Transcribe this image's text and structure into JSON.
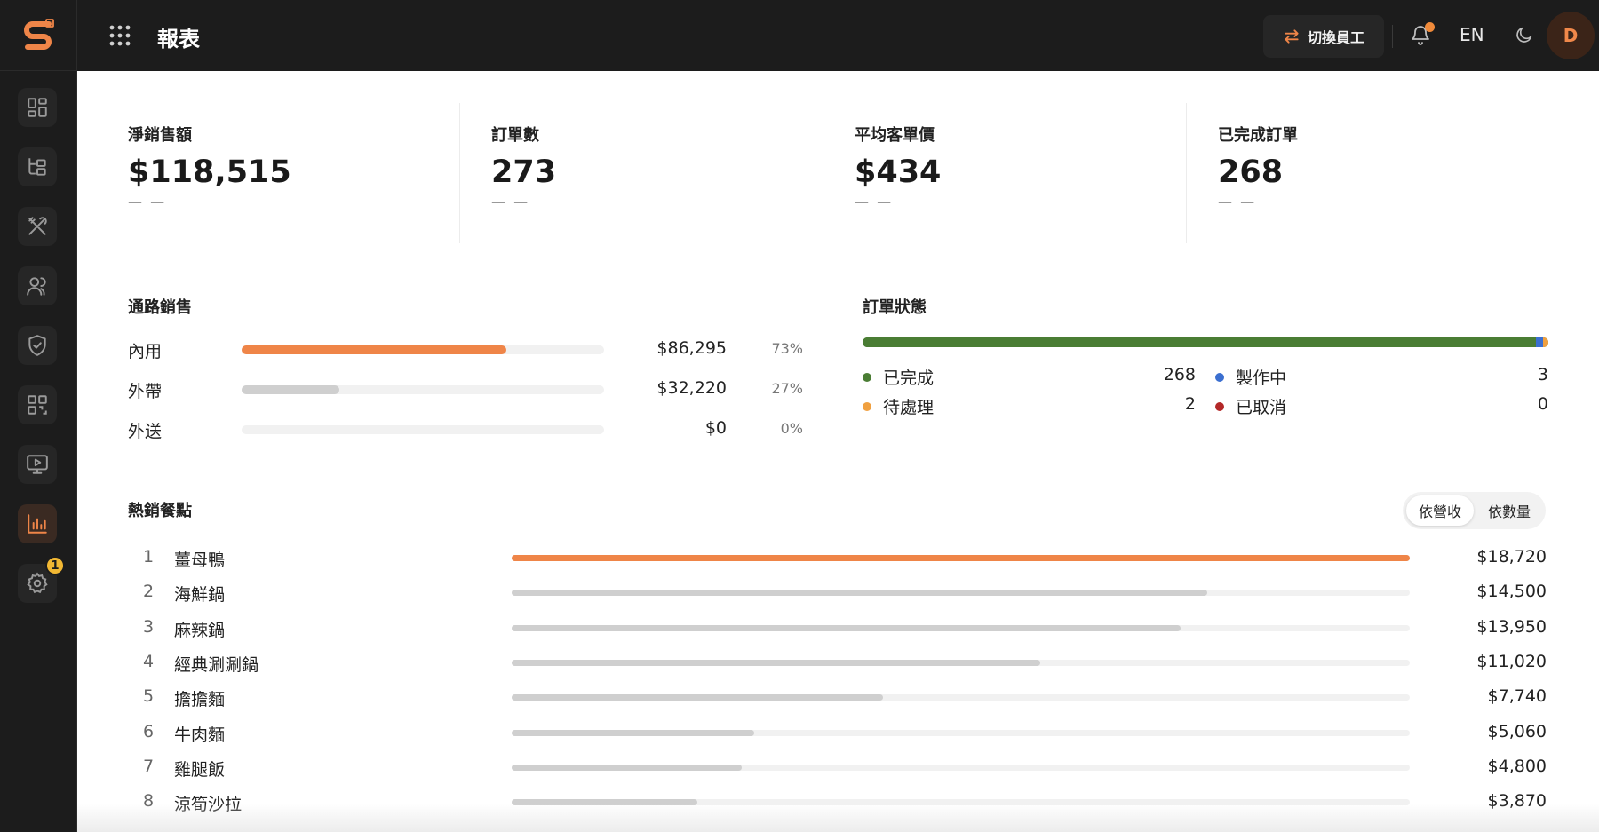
{
  "app": {
    "page_title": "報表"
  },
  "topbar": {
    "switch_label": "切換員工",
    "language": "EN",
    "avatar_initial": "D"
  },
  "sidebar": {
    "items": [
      {
        "icon": "dashboard-icon",
        "active": false
      },
      {
        "icon": "category-tree-icon",
        "active": false
      },
      {
        "icon": "utensils-icon",
        "active": false
      },
      {
        "icon": "users-icon",
        "active": false
      },
      {
        "icon": "shield-icon",
        "active": false
      },
      {
        "icon": "qr-code-icon",
        "active": false
      },
      {
        "icon": "monitor-play-icon",
        "active": false
      },
      {
        "icon": "bar-chart-icon",
        "active": true
      },
      {
        "icon": "gear-icon",
        "active": false,
        "badge": "1"
      }
    ]
  },
  "kpis": [
    {
      "label": "淨銷售額",
      "value": "$118,515",
      "sub": "— —"
    },
    {
      "label": "訂單數",
      "value": "273",
      "sub": "— —"
    },
    {
      "label": "平均客單價",
      "value": "$434",
      "sub": "— —"
    },
    {
      "label": "已完成訂單",
      "value": "268",
      "sub": "— —"
    }
  ],
  "channel_sales": {
    "title": "通路銷售",
    "rows": [
      {
        "name": "內用",
        "amount": "$86,295",
        "pct": "73%",
        "fraction": 0.73,
        "color": "#ef8548"
      },
      {
        "name": "外帶",
        "amount": "$32,220",
        "pct": "27%",
        "fraction": 0.27,
        "color": "#cfcfcf"
      },
      {
        "name": "外送",
        "amount": "$0",
        "pct": "0%",
        "fraction": 0,
        "color": "#cfcfcf"
      }
    ]
  },
  "order_status": {
    "title": "訂單狀態",
    "total": 273,
    "items": [
      {
        "name": "已完成",
        "value": "268",
        "count": 268,
        "color": "#4a7d34"
      },
      {
        "name": "製作中",
        "value": "3",
        "count": 3,
        "color": "#3b6fd0"
      },
      {
        "name": "待處理",
        "value": "2",
        "count": 2,
        "color": "#f0a040"
      },
      {
        "name": "已取消",
        "value": "0",
        "count": 0,
        "color": "#b32828"
      }
    ]
  },
  "top_items": {
    "title": "熱銷餐點",
    "toggle": {
      "by_revenue": "依營收",
      "by_quantity": "依數量",
      "selected": "by_revenue"
    },
    "max": 18720,
    "rows": [
      {
        "rank": "1",
        "name": "薑母鴨",
        "amount": "$18,720",
        "value": 18720
      },
      {
        "rank": "2",
        "name": "海鮮鍋",
        "amount": "$14,500",
        "value": 14500
      },
      {
        "rank": "3",
        "name": "麻辣鍋",
        "amount": "$13,950",
        "value": 13950
      },
      {
        "rank": "4",
        "name": "經典涮涮鍋",
        "amount": "$11,020",
        "value": 11020
      },
      {
        "rank": "5",
        "name": "擔擔麵",
        "amount": "$7,740",
        "value": 7740
      },
      {
        "rank": "6",
        "name": "牛肉麵",
        "amount": "$5,060",
        "value": 5060
      },
      {
        "rank": "7",
        "name": "雞腿飯",
        "amount": "$4,800",
        "value": 4800
      },
      {
        "rank": "8",
        "name": "涼筍沙拉",
        "amount": "$3,870",
        "value": 3870
      }
    ]
  },
  "colors": {
    "accent": "#ef8548",
    "bar_muted": "#cfcfcf",
    "sidebar_bg": "#1c1c1c"
  }
}
